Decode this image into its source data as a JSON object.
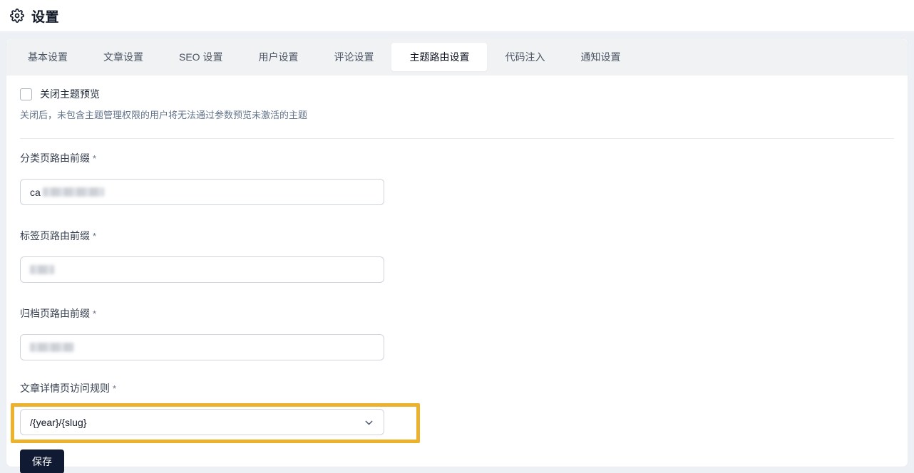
{
  "page": {
    "title": "设置"
  },
  "tabs": {
    "items": [
      {
        "label": "基本设置",
        "active": false
      },
      {
        "label": "文章设置",
        "active": false
      },
      {
        "label": "SEO 设置",
        "active": false
      },
      {
        "label": "用户设置",
        "active": false
      },
      {
        "label": "评论设置",
        "active": false
      },
      {
        "label": "主题路由设置",
        "active": true
      },
      {
        "label": "代码注入",
        "active": false
      },
      {
        "label": "通知设置",
        "active": false
      }
    ]
  },
  "theme_preview": {
    "checkbox_label": "关闭主题预览",
    "checked": false,
    "help_text": "关闭后，未包含主题管理权限的用户将无法通过参数预览未激活的主题"
  },
  "fields": [
    {
      "label": "分类页路由前缀",
      "required_mark": "*",
      "visible_value_prefix": "ca",
      "value_redacted": true
    },
    {
      "label": "标签页路由前缀",
      "required_mark": "*",
      "visible_value_prefix": "",
      "value_redacted": true
    },
    {
      "label": "归档页路由前缀",
      "required_mark": "*",
      "visible_value_prefix": "",
      "value_redacted": true
    }
  ],
  "post_rule_select": {
    "label": "文章详情页访问规则",
    "required_mark": "*",
    "selected_option": "/{year}/{slug}",
    "highlighted": true
  },
  "actions": {
    "save_label": "保存"
  },
  "colors": {
    "highlight_box": "#ecb22e",
    "save_button_bg": "#111a33"
  }
}
